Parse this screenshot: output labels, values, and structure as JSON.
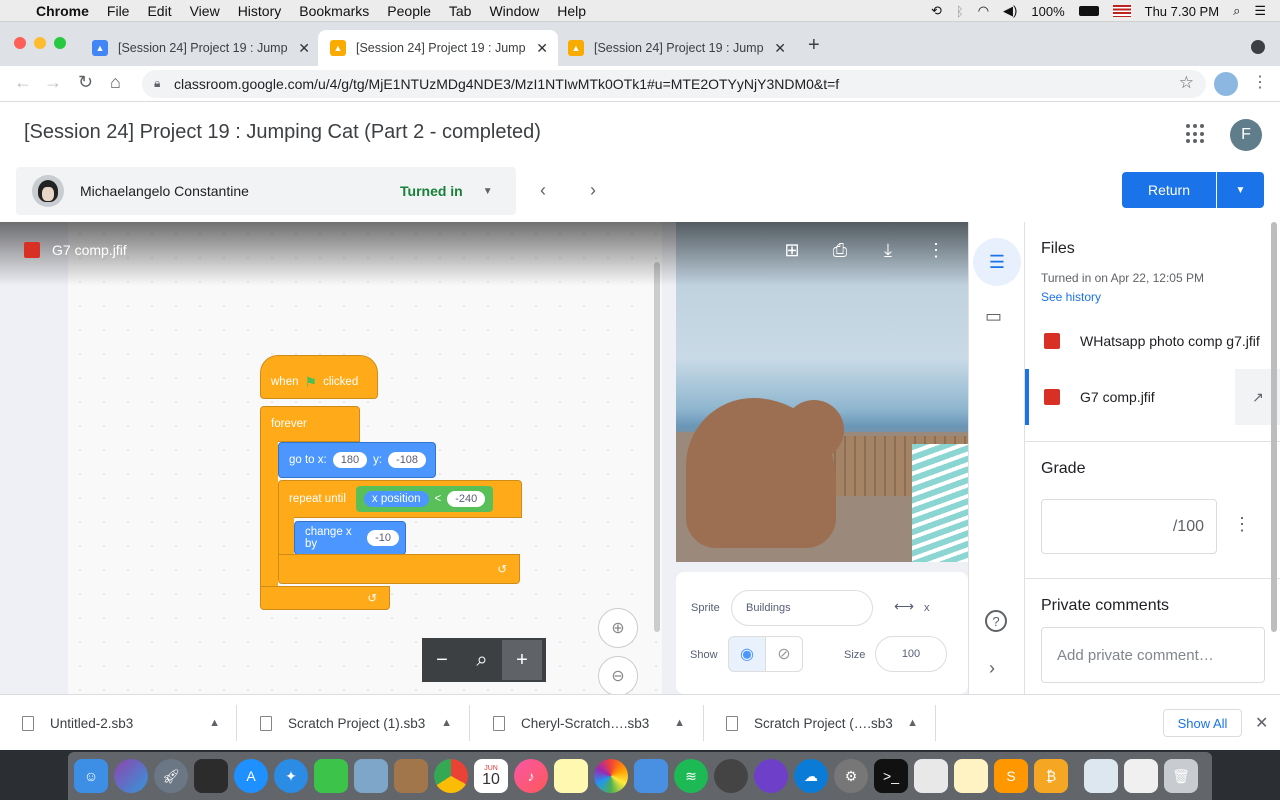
{
  "menubar": {
    "app": "Chrome",
    "menus": [
      "File",
      "Edit",
      "View",
      "History",
      "Bookmarks",
      "People",
      "Tab",
      "Window",
      "Help"
    ],
    "battery": "100%",
    "clock": "Thu 7.30 PM"
  },
  "browser": {
    "tabs": [
      {
        "title": "[Session 24] Project 19 : Jump"
      },
      {
        "title": "[Session 24] Project 19 : Jump"
      },
      {
        "title": "[Session 24] Project 19 : Jump"
      }
    ],
    "url": "classroom.google.com/u/4/g/tg/MjE1NTUzMDg4NDE3/MzI1NTIwMTk0OTk1#u=MTE2OTYyNjY3NDM0&t=f"
  },
  "header": {
    "title": "[Session 24] Project 19 : Jumping Cat (Part 2 - completed)",
    "account_initial": "F",
    "student_name": "Michaelangelo Constantine",
    "status": "Turned in",
    "return_label": "Return"
  },
  "viewer": {
    "filename": "G7 comp.jfif",
    "blocks": {
      "when_flag": "when",
      "clicked": "clicked",
      "forever": "forever",
      "goto": "go to x:",
      "goto_x": "180",
      "goto_y_label": "y:",
      "goto_y": "-108",
      "repeat_until": "repeat until",
      "x_position": "x position",
      "lt": "<",
      "lt_value": "-240",
      "change_x": "change x by",
      "change_x_value": "-10"
    },
    "sprite_panel": {
      "sprite_label": "Sprite",
      "sprite_name": "Buildings",
      "x_label": "x",
      "show_label": "Show",
      "size_label": "Size",
      "size_value": "100"
    }
  },
  "sidepanel": {
    "files_heading": "Files",
    "turned_in": "Turned in on Apr 22, 12:05 PM",
    "see_history": "See history",
    "files": [
      {
        "name": "WHatsapp photo comp g7.jfif"
      },
      {
        "name": "G7 comp.jfif"
      }
    ],
    "grade_heading": "Grade",
    "grade_suffix": "/100",
    "comments_heading": "Private comments",
    "comment_placeholder": "Add private comment…"
  },
  "downloads": {
    "items": [
      {
        "name": "Untitled-2.sb3"
      },
      {
        "name": "Scratch Project (1).sb3"
      },
      {
        "name": "Cheryl-Scratch….sb3"
      },
      {
        "name": "Scratch Project (….sb3"
      }
    ],
    "show_all": "Show All"
  },
  "dock": {
    "calendar_month": "JUN",
    "calendar_day": "10"
  },
  "colors": {
    "accent": "#1a73e8",
    "turned_in": "#188038",
    "scratch_orange": "#ffab19",
    "scratch_blue": "#4c97ff",
    "scratch_green": "#59c059"
  }
}
